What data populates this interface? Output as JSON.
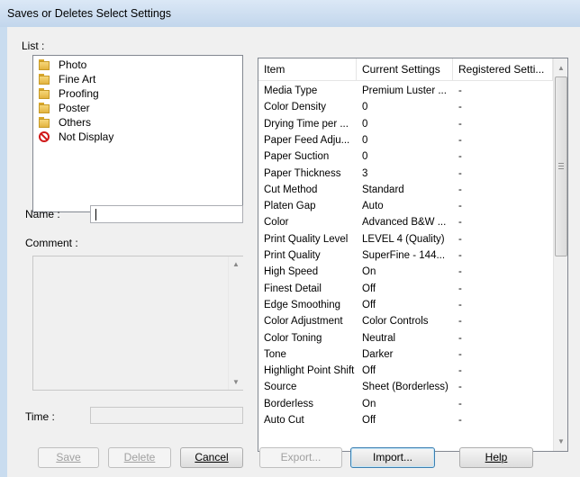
{
  "window": {
    "title": "Saves or Deletes Select Settings"
  },
  "list": {
    "label": "List :",
    "items": [
      {
        "label": "Photo",
        "icon": "folder-icon"
      },
      {
        "label": "Fine Art",
        "icon": "folder-icon"
      },
      {
        "label": "Proofing",
        "icon": "folder-icon"
      },
      {
        "label": "Poster",
        "icon": "folder-icon"
      },
      {
        "label": "Others",
        "icon": "folder-icon"
      },
      {
        "label": "Not Display",
        "icon": "no-entry-icon"
      }
    ]
  },
  "name": {
    "label": "Name :",
    "value": ""
  },
  "comment": {
    "label": "Comment :",
    "value": ""
  },
  "time": {
    "label": "Time :",
    "value": ""
  },
  "table": {
    "columns": [
      "Item",
      "Current Settings",
      "Registered Setti..."
    ],
    "rows": [
      [
        "Media Type",
        "Premium Luster ...",
        "-"
      ],
      [
        "Color Density",
        "0",
        "-"
      ],
      [
        "Drying Time per ...",
        "0",
        "-"
      ],
      [
        "Paper Feed Adju...",
        "0",
        "-"
      ],
      [
        "Paper Suction",
        "0",
        "-"
      ],
      [
        "Paper Thickness",
        "3",
        "-"
      ],
      [
        "Cut Method",
        "Standard",
        "-"
      ],
      [
        "Platen Gap",
        "Auto",
        "-"
      ],
      [
        "Color",
        "Advanced B&W ...",
        "-"
      ],
      [
        "Print Quality Level",
        "LEVEL 4 (Quality)",
        "-"
      ],
      [
        "Print Quality",
        "SuperFine - 144...",
        "-"
      ],
      [
        "High Speed",
        "On",
        "-"
      ],
      [
        "Finest Detail",
        "Off",
        "-"
      ],
      [
        "Edge Smoothing",
        "Off",
        "-"
      ],
      [
        "Color Adjustment",
        "Color Controls",
        "-"
      ],
      [
        "Color Toning",
        "Neutral",
        "-"
      ],
      [
        "Tone",
        "Darker",
        "-"
      ],
      [
        "Highlight Point Shift",
        "Off",
        "-"
      ],
      [
        "Source",
        "Sheet (Borderless)",
        "-"
      ],
      [
        "Borderless",
        "On",
        "-"
      ],
      [
        "Auto Cut",
        "Off",
        "-"
      ]
    ]
  },
  "buttons": {
    "save": "Save",
    "delete": "Delete",
    "cancel": "Cancel",
    "export": "Export...",
    "import": "Import...",
    "help": "Help"
  }
}
